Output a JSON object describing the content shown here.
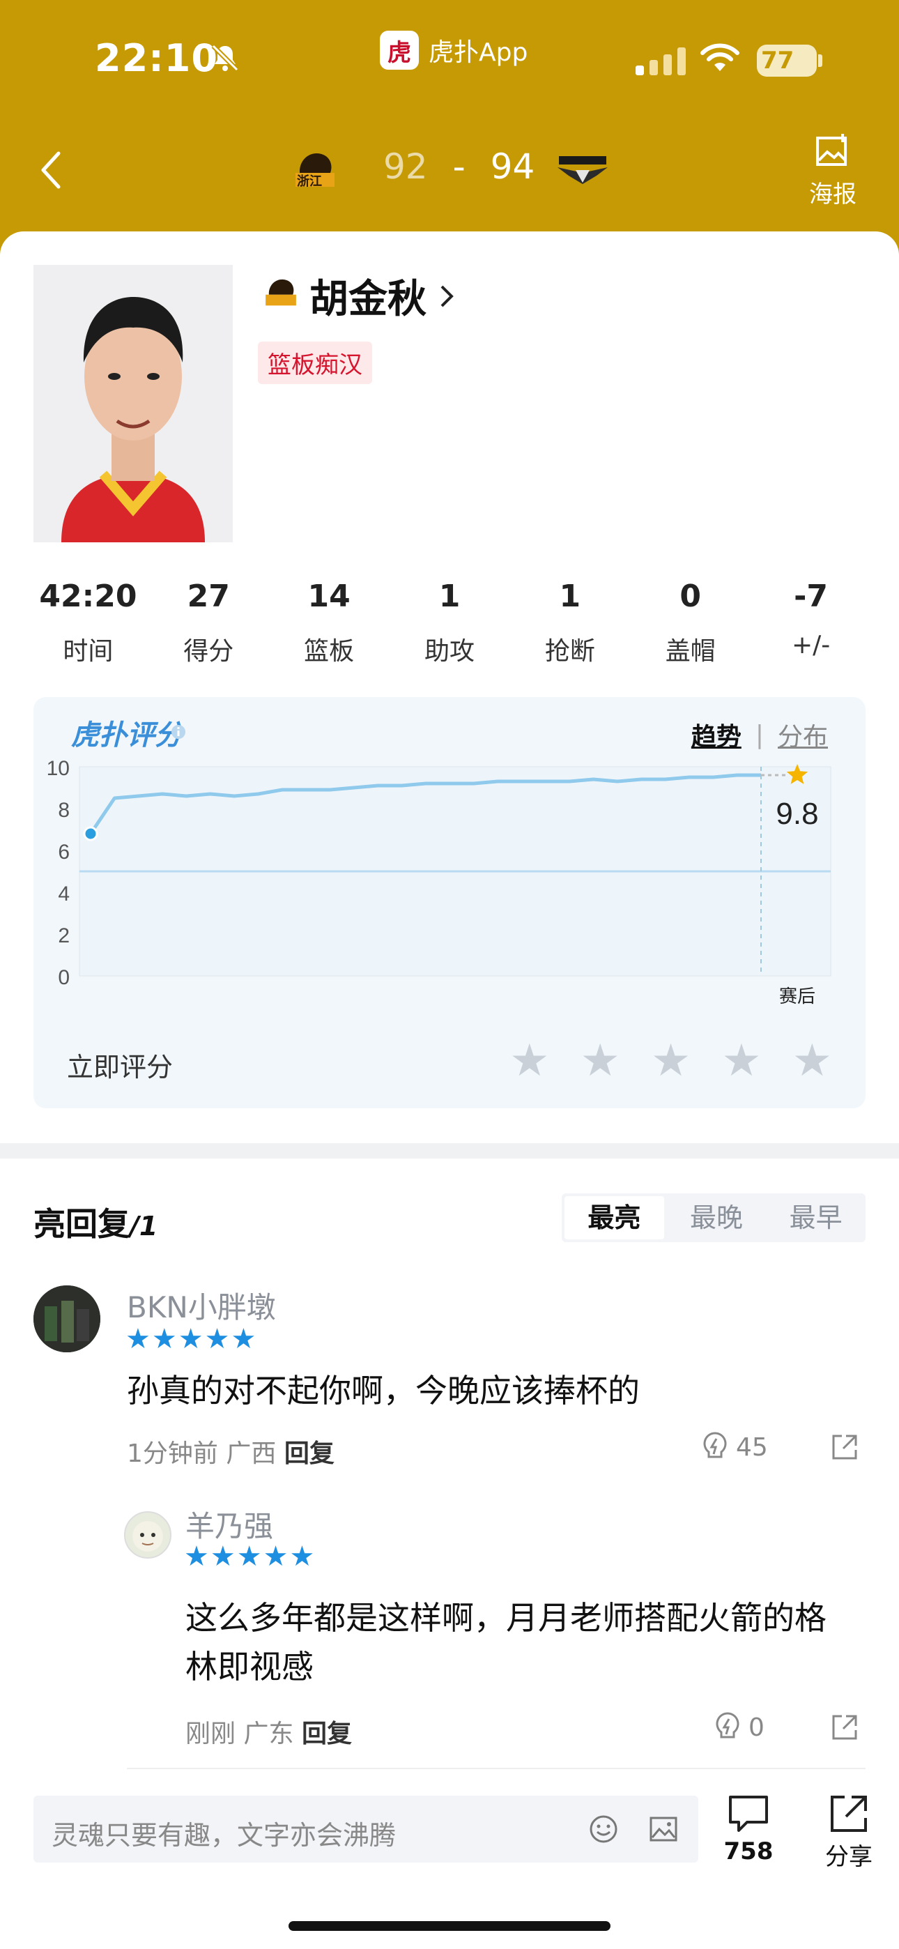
{
  "status_bar": {
    "time": "22:10",
    "app_name": "虎扑App",
    "battery": "77"
  },
  "header": {
    "home_score": "92",
    "dash": "-",
    "away_score": "94",
    "poster_label": "海报",
    "home_team_logo_text": "浙江"
  },
  "player": {
    "name": "胡金秋",
    "tag": "篮板痴汉",
    "team_logo_text": "浙江"
  },
  "stats": [
    {
      "value": "42:20",
      "label": "时间"
    },
    {
      "value": "27",
      "label": "得分"
    },
    {
      "value": "14",
      "label": "篮板"
    },
    {
      "value": "1",
      "label": "助攻"
    },
    {
      "value": "1",
      "label": "抢断"
    },
    {
      "value": "0",
      "label": "盖帽"
    },
    {
      "value": "-7",
      "label": "+/-"
    }
  ],
  "rating": {
    "title": "虎扑评分",
    "tab_trend": "趋势",
    "tab_dist": "分布",
    "score": "9.8",
    "end_label": "赛后",
    "rate_now": "立即评分"
  },
  "chart_data": {
    "type": "line",
    "y_ticks": [
      "10",
      "8",
      "6",
      "4",
      "2",
      "0"
    ],
    "ylim": [
      0,
      10
    ],
    "x_end_label": "赛后",
    "reference_line": 5.0,
    "series": [
      {
        "values": [
          6.8,
          8.5,
          8.6,
          8.7,
          8.6,
          8.7,
          8.6,
          8.7,
          8.9,
          8.9,
          8.9,
          9.0,
          9.1,
          9.1,
          9.2,
          9.2,
          9.2,
          9.3,
          9.3,
          9.3,
          9.3,
          9.4,
          9.3,
          9.4,
          9.4,
          9.5,
          9.5,
          9.6,
          9.6
        ]
      }
    ],
    "final_value": 9.8,
    "colors": {
      "line": "#8fc9ec",
      "point": "#2b9ee0",
      "star": "#f5b400"
    }
  },
  "replies": {
    "title": "亮回复",
    "count": "/1",
    "sort": [
      "最亮",
      "最晚",
      "最早"
    ],
    "items": [
      {
        "user": "BKN小胖墩",
        "stars": "★★★★★",
        "text": "孙真的对不起你啊，今晚应该捧杯的",
        "time": "1分钟前",
        "region": "广西",
        "reply": "回复",
        "lights": "45"
      },
      {
        "user": "羊乃强",
        "stars": "★★★★★",
        "text": "这么多年都是这样啊，月月老师搭配火箭的格林即视感",
        "time": "刚刚",
        "region": "广东",
        "reply": "回复",
        "lights": "0"
      }
    ]
  },
  "bottom": {
    "placeholder": "灵魂只要有趣，文字亦会沸腾",
    "comment_count": "758",
    "share": "分享"
  }
}
